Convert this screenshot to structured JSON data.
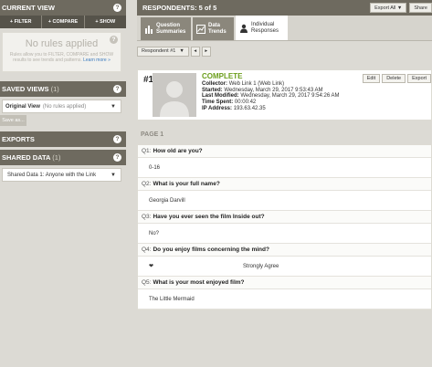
{
  "left_panel": {
    "current_view": {
      "title": "CURRENT VIEW",
      "help": "?"
    },
    "filter_bar": {
      "filter": "+ FILTER",
      "compare": "+ COMPARE",
      "show": "+ SHOW"
    },
    "rules_box": {
      "title": "No rules applied",
      "text": "Rules allow you to FILTER, COMPARE and SHOW results to see trends and patterns.",
      "learn_more": "Learn more »"
    },
    "saved_views": {
      "title": "SAVED VIEWS",
      "count": "(1)",
      "item_name": "Original View",
      "item_note": "(No rules applied)",
      "save_as": "Save as..."
    },
    "exports": {
      "title": "EXPORTS"
    },
    "shared_data": {
      "title": "SHARED DATA",
      "count": "(1)",
      "item": "Shared Data 1: Anyone with the Link"
    }
  },
  "main": {
    "header": {
      "title": "RESPONDENTS: 5 of 5",
      "export_all": "Export All",
      "share": "Share"
    },
    "tabs": [
      {
        "label": "Question Summaries"
      },
      {
        "label": "Data Trends"
      },
      {
        "label": "Individual Responses"
      }
    ],
    "respondent_select": "Respondent #1",
    "card": {
      "number": "#1",
      "status": "COMPLETE",
      "collector_label": "Collector:",
      "collector_value": "Web Link 1 (Web Link)",
      "started_label": "Started:",
      "started_value": "Wednesday, March 29, 2017 9:53:43 AM",
      "modified_label": "Last Modified:",
      "modified_value": "Wednesday, March 29, 2017 9:54:26 AM",
      "time_label": "Time Spent:",
      "time_value": "00:00:42",
      "ip_label": "IP Address:",
      "ip_value": "193.63.42.35",
      "edit": "Edit",
      "delete": "Delete",
      "export": "Export"
    },
    "page_label": "PAGE 1",
    "questions": [
      {
        "num": "Q1:",
        "text": "How old are you?",
        "answer": "0-16"
      },
      {
        "num": "Q2:",
        "text": "What is your full name?",
        "answer": "Georgia Darvill"
      },
      {
        "num": "Q3:",
        "text": "Have you ever seen the film Inside out?",
        "answer": "No?"
      },
      {
        "num": "Q4:",
        "text": "Do you enjoy films concerning the mind?",
        "answer": "Strongly Agree"
      },
      {
        "num": "Q5:",
        "text": "What is your most enjoyed film?",
        "answer": "The Little Mermaid"
      }
    ]
  },
  "colors": {
    "header": "#6e6a5f",
    "complete": "#6a9d1a",
    "link": "#3b7bbf"
  }
}
